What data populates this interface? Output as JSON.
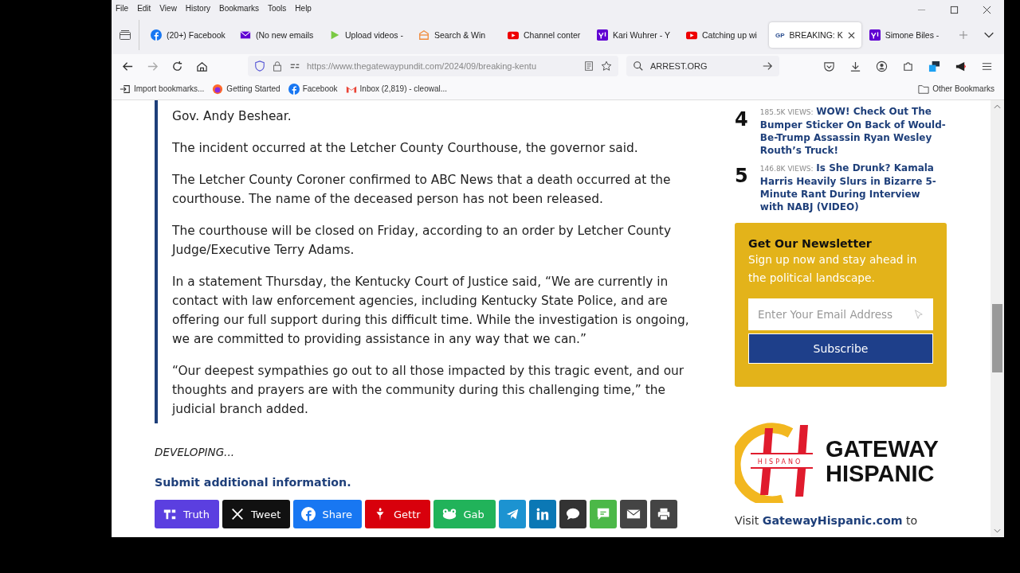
{
  "menu_bar": [
    "File",
    "Edit",
    "View",
    "History",
    "Bookmarks",
    "Tools",
    "Help"
  ],
  "tabs": [
    {
      "label": "(20+) Facebook",
      "kind": "facebook",
      "selected": false
    },
    {
      "label": "(No new emails",
      "kind": "mail",
      "selected": false
    },
    {
      "label": "Upload videos -",
      "kind": "play",
      "selected": false
    },
    {
      "label": "Search & Win",
      "kind": "box",
      "selected": false
    },
    {
      "label": "Channel conter",
      "kind": "youtube",
      "selected": false
    },
    {
      "label": "Kari Wuhrer - Y",
      "kind": "yahoo",
      "selected": false
    },
    {
      "label": "Catching up wi",
      "kind": "youtube",
      "selected": false
    },
    {
      "label": "BREAKING: K",
      "kind": "text",
      "icon_text": "GP",
      "selected": true
    },
    {
      "label": "Simone Biles - ",
      "kind": "yahoo",
      "selected": false
    }
  ],
  "address_bar": {
    "url": "https://www.thegatewaypundit.com/2024/09/breaking-kentu",
    "search": "ARREST.ORG"
  },
  "bookmarks": [
    {
      "label": "Import bookmarks...",
      "kind": "import"
    },
    {
      "label": "Getting Started",
      "kind": "firefox"
    },
    {
      "label": "Facebook",
      "kind": "facebook"
    },
    {
      "label": "Inbox (2,819) - cleowal...",
      "kind": "gmail"
    }
  ],
  "other_bookmarks": "Other Bookmarks",
  "article": {
    "quote_paragraphs": [
      "Gov. Andy Beshear.",
      "The incident occurred at the Letcher County Courthouse, the governor said.",
      "The Letcher County Coroner confirmed to ABC News that a death occurred at the courthouse. The name of the deceased person has not been released.",
      "The courthouse will be closed on Friday, according to an order by Letcher County Judge/Executive Terry Adams.",
      "In a statement Thursday, the Kentucky Court of Justice said, “We are currently in contact with law enforcement agencies, including Kentucky State Police, and are offering our full support during this difficult time. While the investigation is ongoing, we are committed to providing assistance in any way that we can.”",
      "“Our deepest sympathies go out to all those impacted by this tragic event, and our thoughts and prayers are with the community during this challenging time,” the judicial branch added."
    ],
    "developing": "DEVELOPING...",
    "submit_link": "Submit additional information.",
    "share_buttons": [
      {
        "kind": "truth",
        "label": "Truth",
        "color": "#5b3fe0"
      },
      {
        "kind": "x",
        "label": "Tweet",
        "color": "#111111"
      },
      {
        "kind": "facebook",
        "label": "Share",
        "color": "#1877f2"
      },
      {
        "kind": "gettr",
        "label": "Gettr",
        "color": "#d8000c"
      },
      {
        "kind": "gab",
        "label": "Gab",
        "color": "#21b35a"
      },
      {
        "kind": "telegram",
        "color": "#1c93d1"
      },
      {
        "kind": "linkedin",
        "color": "#0b78b5"
      },
      {
        "kind": "comment",
        "color": "#333333"
      },
      {
        "kind": "sms",
        "color": "#4cb848"
      },
      {
        "kind": "email",
        "color": "#444444"
      },
      {
        "kind": "print",
        "color": "#444444"
      }
    ]
  },
  "sidebar": {
    "trending": [
      {
        "rank": "4",
        "views": "185.5K VIEWS:",
        "title": "WOW! Check Out The Bumper Sticker On Back of Would-Be-Trump Assassin Ryan Wesley Routh’s Truck!"
      },
      {
        "rank": "5",
        "views": "146.8K VIEWS:",
        "title": "Is She Drunk? Kamala Harris Heavily Slurs in Bizarre 5-Minute Rant During Interview with NABJ (VIDEO)"
      }
    ],
    "newsletter": {
      "title": "Get Our Newsletter",
      "text": "Sign up now and stay ahead in the political landscape.",
      "placeholder": "Enter Your Email Address",
      "button": "Subscribe"
    },
    "logo": {
      "mark_text": "HISPANO",
      "line_1": "GATEWAY",
      "line_2": "HISPANIC"
    },
    "visit": {
      "before": "Visit ",
      "link": "GatewayHispanic.com",
      "after": " to"
    }
  }
}
